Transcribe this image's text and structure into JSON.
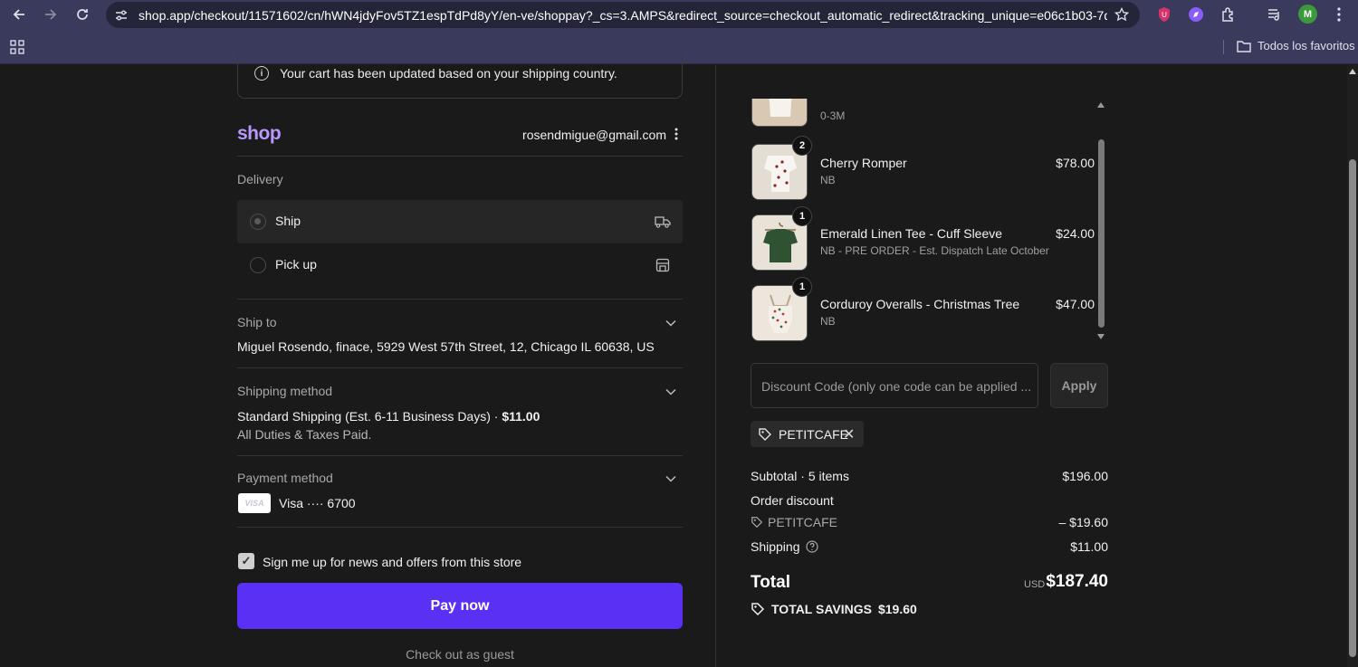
{
  "browser": {
    "url": "shop.app/checkout/11571602/cn/hWN4jdyFov5TZ1espTdPd8yY/en-ve/shoppay?_cs=3.AMPS&redirect_source=checkout_automatic_redirect&tracking_unique=e06c1b03-7d5...",
    "avatar_letter": "M",
    "bookmarks_label": "Todos los favoritos"
  },
  "notice": {
    "text": "Your cart has been updated based on your shipping country."
  },
  "account": {
    "logo": "shop",
    "email": "rosendmigue@gmail.com"
  },
  "delivery": {
    "label": "Delivery",
    "options": [
      {
        "label": "Ship",
        "selected": true
      },
      {
        "label": "Pick up",
        "selected": false
      }
    ]
  },
  "ship_to": {
    "label": "Ship to",
    "address": "Miguel Rosendo, finace, 5929 West 57th Street, 12, Chicago IL 60638, US"
  },
  "shipping_method": {
    "label": "Shipping method",
    "name": "Standard Shipping (Est. 6-11 Business Days) · ",
    "price": "$11.00",
    "note": "All Duties & Taxes Paid."
  },
  "payment_method": {
    "label": "Payment method",
    "card_brand": "VISA",
    "card_number": "Visa ···· 6700"
  },
  "newsletter": {
    "label": "Sign me up for news and offers from this store",
    "checked": true
  },
  "pay_button": "Pay now",
  "guest_link": "Check out as guest",
  "cart": {
    "partial_item_variant": "0-3M",
    "items": [
      {
        "name": "Cherry Romper",
        "variant": "NB",
        "price": "$78.00",
        "qty": "2"
      },
      {
        "name": "Emerald Linen Tee - Cuff Sleeve",
        "variant": "NB - PRE ORDER - Est. Dispatch Late October",
        "price": "$24.00",
        "qty": "1"
      },
      {
        "name": "Corduroy Overalls - Christmas Tree",
        "variant": "NB",
        "price": "$47.00",
        "qty": "1"
      }
    ]
  },
  "discount": {
    "placeholder": "Discount Code (only one code can be applied ...",
    "apply_label": "Apply",
    "applied_code": "PETITCAFE"
  },
  "summary": {
    "subtotal_label": "Subtotal · 5 items",
    "subtotal_value": "$196.00",
    "order_discount_label": "Order discount",
    "discount_code": "PETITCAFE",
    "discount_value": "– $19.60",
    "shipping_label": "Shipping",
    "shipping_value": "$11.00",
    "total_label": "Total",
    "currency": "USD",
    "total_value": "$187.40",
    "savings_label": "TOTAL SAVINGS",
    "savings_value": "$19.60"
  },
  "colors": {
    "accent": "#5a31f4",
    "shop_logo": "#b898ff"
  }
}
